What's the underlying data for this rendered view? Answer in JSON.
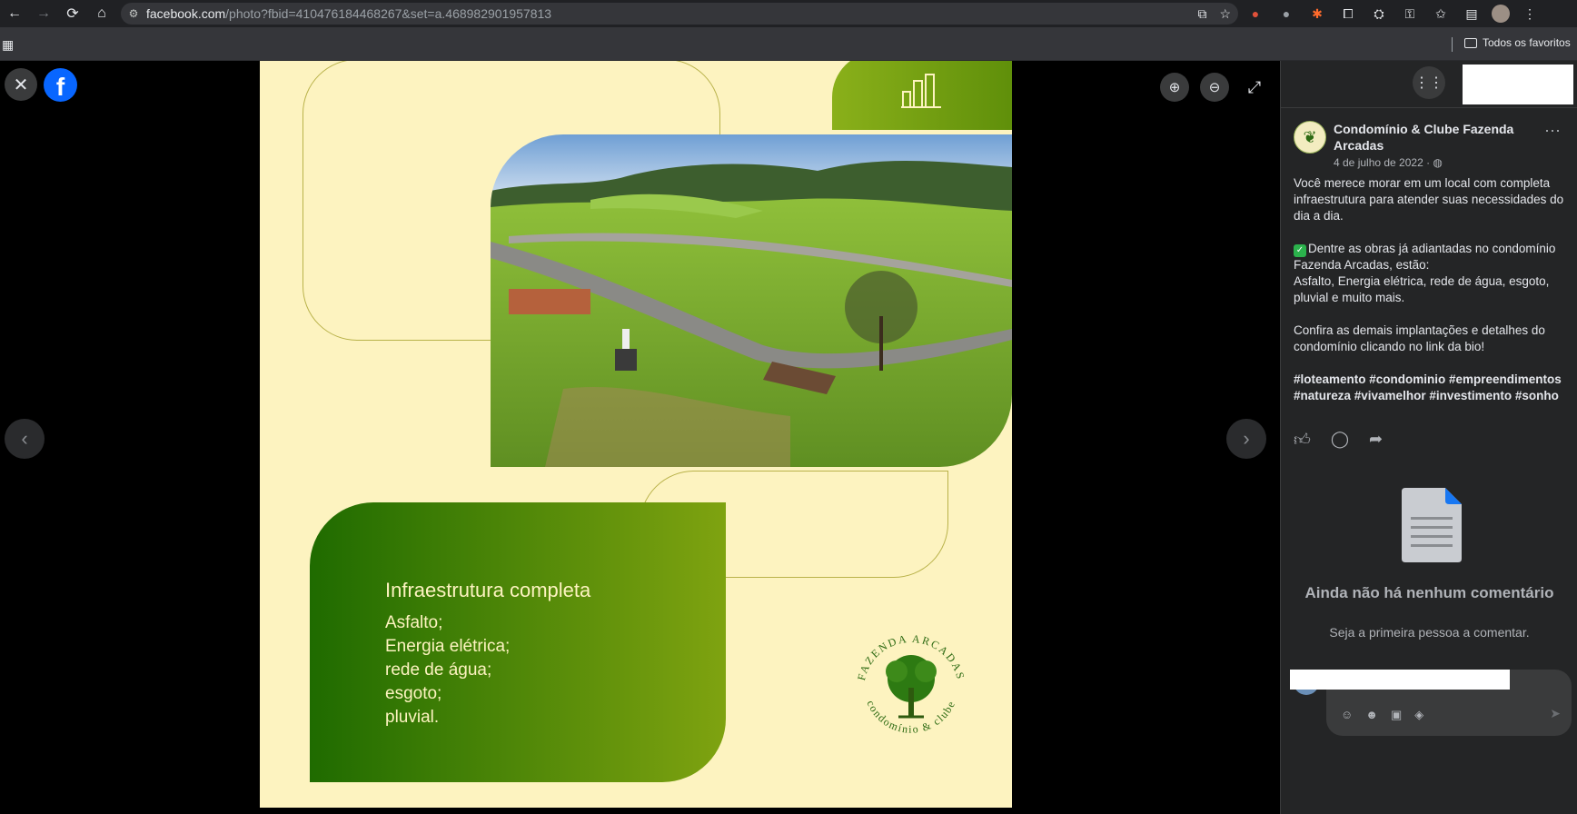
{
  "browser": {
    "url_host": "facebook.com",
    "url_path": "/photo?fbid=410476184468267&set=a.468982901957813",
    "bookmark_folder": "Todos os favoritos"
  },
  "photo": {
    "card_title": "Infraestrutura completa",
    "card_lines": [
      "Asfalto;",
      "Energia elétrica;",
      "rede de água;",
      "esgoto;",
      "pluvial."
    ],
    "logo_top_text": "FAZENDA ARCADAS",
    "logo_bottom_text": "condomínio & clube"
  },
  "post": {
    "page_name": "Condomínio & Clube Fazenda Arcadas",
    "date": "4 de julho de 2022 · ",
    "paragraph1": "Você merece morar em um local com completa infraestrutura para atender suas necessidades do dia a dia.",
    "paragraph2_line1": "Dentre as obras já adiantadas no condomínio Fazenda Arcadas, estão:",
    "paragraph2_line2": "Asfalto, Energia elétrica, rede de água, esgoto, pluvial e muito mais.",
    "paragraph3": "Confira as demais implantações e detalhes do condomínio clicando no link da bio!",
    "hashtags": "#loteamento #condominio #empreendimentos #natureza #vivamelhor #investimento #sonho"
  },
  "comments": {
    "empty_title": "Ainda não há nenhum comentário",
    "empty_subtitle": "Seja a primeira pessoa a comentar."
  },
  "icons": {
    "like": "like-icon",
    "comment": "comment-icon",
    "share": "share-icon"
  }
}
